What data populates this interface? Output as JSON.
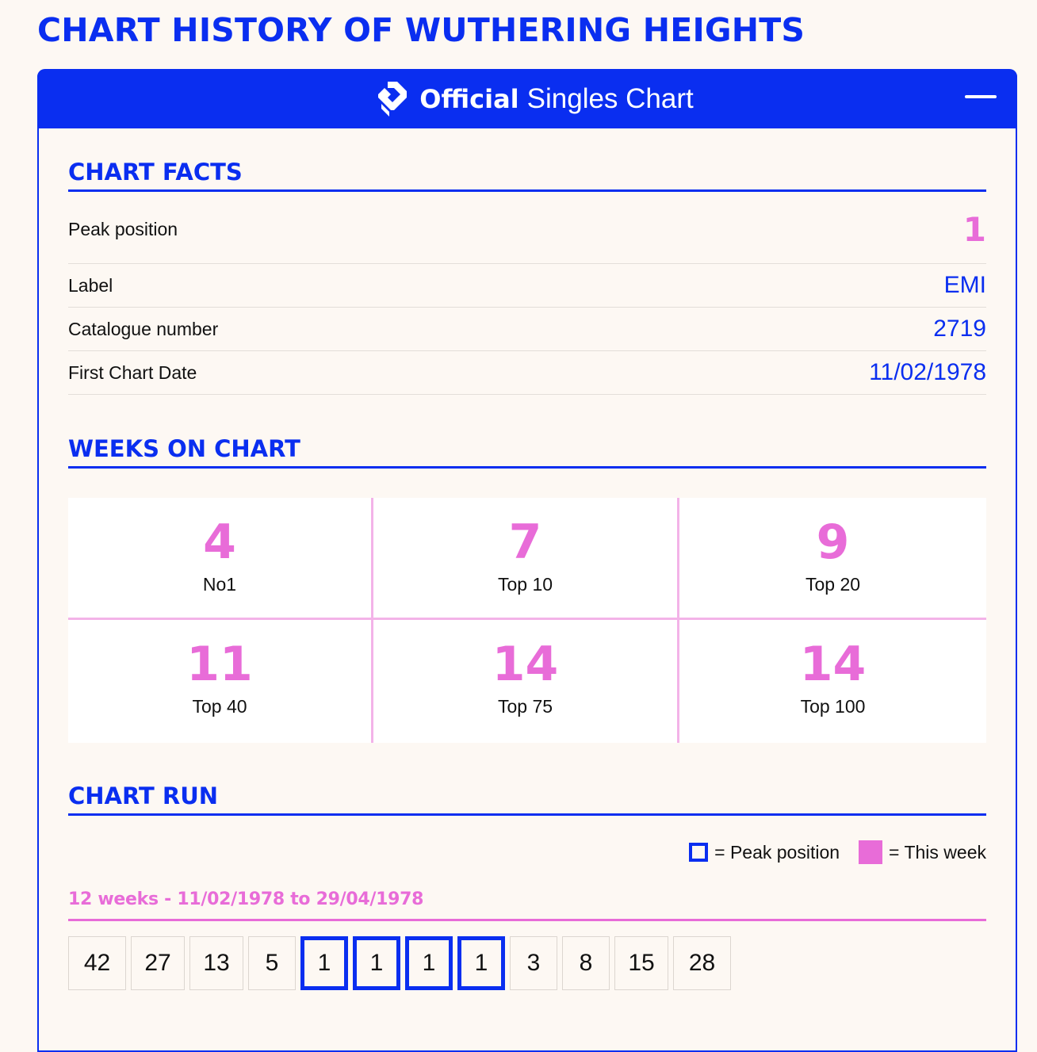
{
  "page": {
    "title": "CHART HISTORY OF WUTHERING HEIGHTS"
  },
  "panel": {
    "brand_strong": "Official",
    "brand_light": "Singles Chart",
    "collapse_icon": "minus-icon"
  },
  "chart_facts": {
    "heading": "CHART FACTS",
    "rows": [
      {
        "label": "Peak position",
        "value": "1"
      },
      {
        "label": "Label",
        "value": "EMI"
      },
      {
        "label": "Catalogue number",
        "value": "2719"
      },
      {
        "label": "First Chart Date",
        "value": "11/02/1978"
      }
    ]
  },
  "weeks_on_chart": {
    "heading": "WEEKS ON CHART",
    "cells": [
      {
        "value": "4",
        "label": "No1"
      },
      {
        "value": "7",
        "label": "Top 10"
      },
      {
        "value": "9",
        "label": "Top 20"
      },
      {
        "value": "11",
        "label": "Top 40"
      },
      {
        "value": "14",
        "label": "Top 75"
      },
      {
        "value": "14",
        "label": "Top 100"
      }
    ]
  },
  "chart_run": {
    "heading": "CHART RUN",
    "legend_peak": "= Peak position",
    "legend_this_week": "= This week",
    "summary": "12 weeks - 11/02/1978 to 29/04/1978",
    "positions": [
      "42",
      "27",
      "13",
      "5",
      "1",
      "1",
      "1",
      "1",
      "3",
      "8",
      "15",
      "28"
    ]
  },
  "colors": {
    "brand_blue": "#0a2ef0",
    "accent_pink": "#e86cd8",
    "background": "#fdf8f3"
  }
}
